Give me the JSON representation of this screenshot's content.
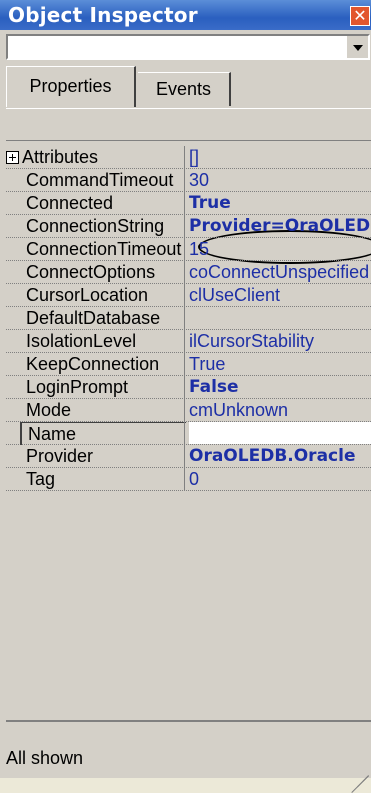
{
  "window": {
    "title": "Object Inspector",
    "close_glyph": "✕"
  },
  "component_selector": {
    "value": ""
  },
  "tabs": [
    {
      "label": "Properties",
      "active": true
    },
    {
      "label": "Events",
      "active": false
    }
  ],
  "properties": [
    {
      "name": "Attributes",
      "value": "[]",
      "expandable": true,
      "bold": false
    },
    {
      "name": "CommandTimeout",
      "value": "30",
      "bold": false
    },
    {
      "name": "Connected",
      "value": "True",
      "bold": true
    },
    {
      "name": "ConnectionString",
      "value": "Provider=OraOLEDB",
      "bold": true,
      "highlighted": true
    },
    {
      "name": "ConnectionTimeout",
      "value": "15",
      "bold": false
    },
    {
      "name": "ConnectOptions",
      "value": "coConnectUnspecified",
      "bold": false
    },
    {
      "name": "CursorLocation",
      "value": "clUseClient",
      "bold": false
    },
    {
      "name": "DefaultDatabase",
      "value": "",
      "bold": false
    },
    {
      "name": "IsolationLevel",
      "value": "ilCursorStability",
      "bold": false
    },
    {
      "name": "KeepConnection",
      "value": "True",
      "bold": false
    },
    {
      "name": "LoginPrompt",
      "value": "False",
      "bold": true
    },
    {
      "name": "Mode",
      "value": "cmUnknown",
      "bold": false
    },
    {
      "name": "Name",
      "value": "",
      "bold": false,
      "selected": true
    },
    {
      "name": "Provider",
      "value": "OraOLEDB.Oracle",
      "bold": true
    },
    {
      "name": "Tag",
      "value": "0",
      "bold": false
    }
  ],
  "status": {
    "text": "All shown"
  },
  "colors": {
    "title_bar": "#2a5fbf",
    "value_text": "#1d2fa6",
    "close_button": "#e2562d"
  }
}
